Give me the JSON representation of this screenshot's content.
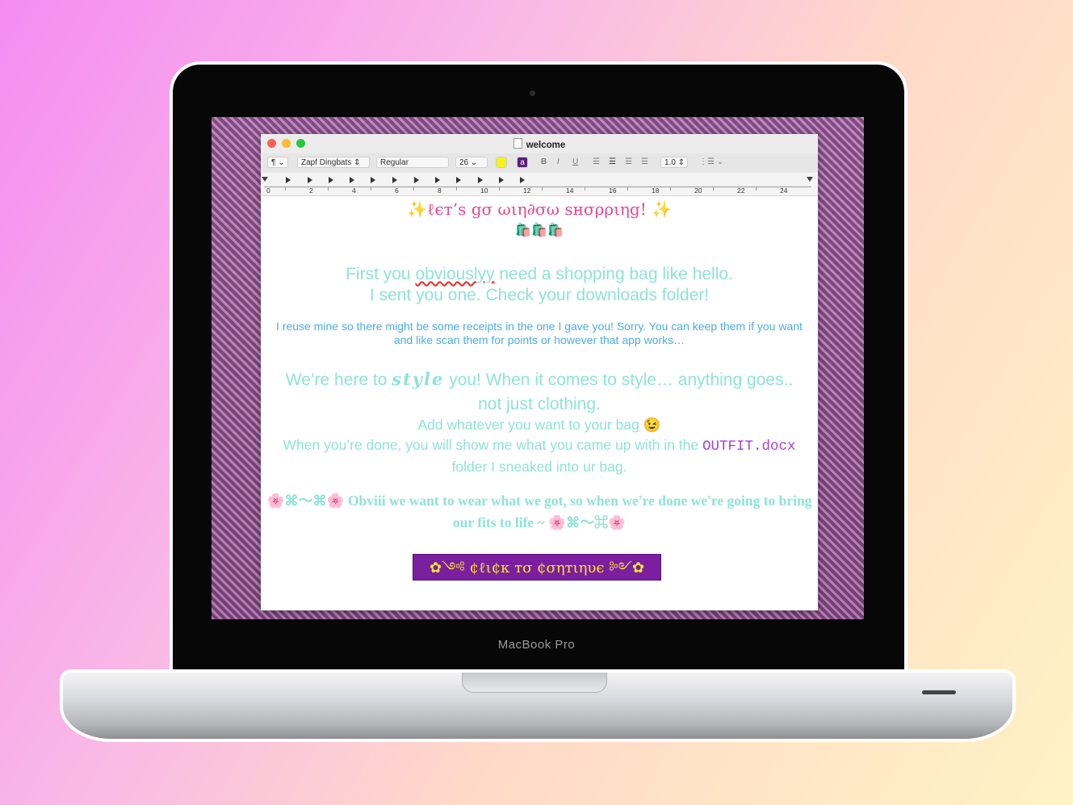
{
  "window": {
    "title": "welcome",
    "traffic_lights": {
      "close": "#fe5f57",
      "minimize": "#febc2e",
      "zoom": "#28c840"
    }
  },
  "toolbar": {
    "paragraph_style": "¶",
    "font_family": "Zapf Dingbats",
    "font_style": "Regular",
    "font_size": "26",
    "highlight_color": "#f2f21a",
    "text_color_label": "a",
    "bold": "B",
    "italic": "I",
    "underline": "U",
    "line_spacing": "1.0",
    "list_icon": "list-bullets-icon"
  },
  "ruler": {
    "numbers": [
      "0",
      "2",
      "4",
      "6",
      "8",
      "10",
      "12",
      "14",
      "16",
      "18",
      "20",
      "22",
      "24"
    ]
  },
  "document": {
    "heading": "✨ℓєт’ѕ gσ ωιη∂σω ѕнσρριηg! ✨",
    "bags": "🛍️🛍️🛍️",
    "para1_a": "First you ",
    "para1_misspelled": "obviouslyy",
    "para1_b": " need a shopping bag like hello.",
    "para1_line2": "I sent you one. Check your downloads folder!",
    "para2": "I reuse mine so there might be some receipts in the one I gave you! Sorry. You can keep them if you want and like scan them for points or however that app works…",
    "para3_a": "We’re here to ",
    "para3_style": "style",
    "para3_b": " you! When it comes to style… anything goes.. not just clothing.",
    "para4_line1": "Add whatever you want to your bag 😉",
    "para4_a": "When you’re done, you will show me what you came up with in the ",
    "para4_file": "OUTFIT.docx",
    "para4_b": " folder I sneaked into ur bag.",
    "para5": "🌸⌘〜⌘🌸 Obviii we want to wear what we got, so when we're done we're going to bring our fits to life ~ 🌸⌘〜⌘🌸",
    "cta_label": "✿༺ ¢ℓι¢к тσ ¢σηтιηυє ༻✿"
  },
  "device": {
    "brand_label": "MacBook Pro"
  }
}
